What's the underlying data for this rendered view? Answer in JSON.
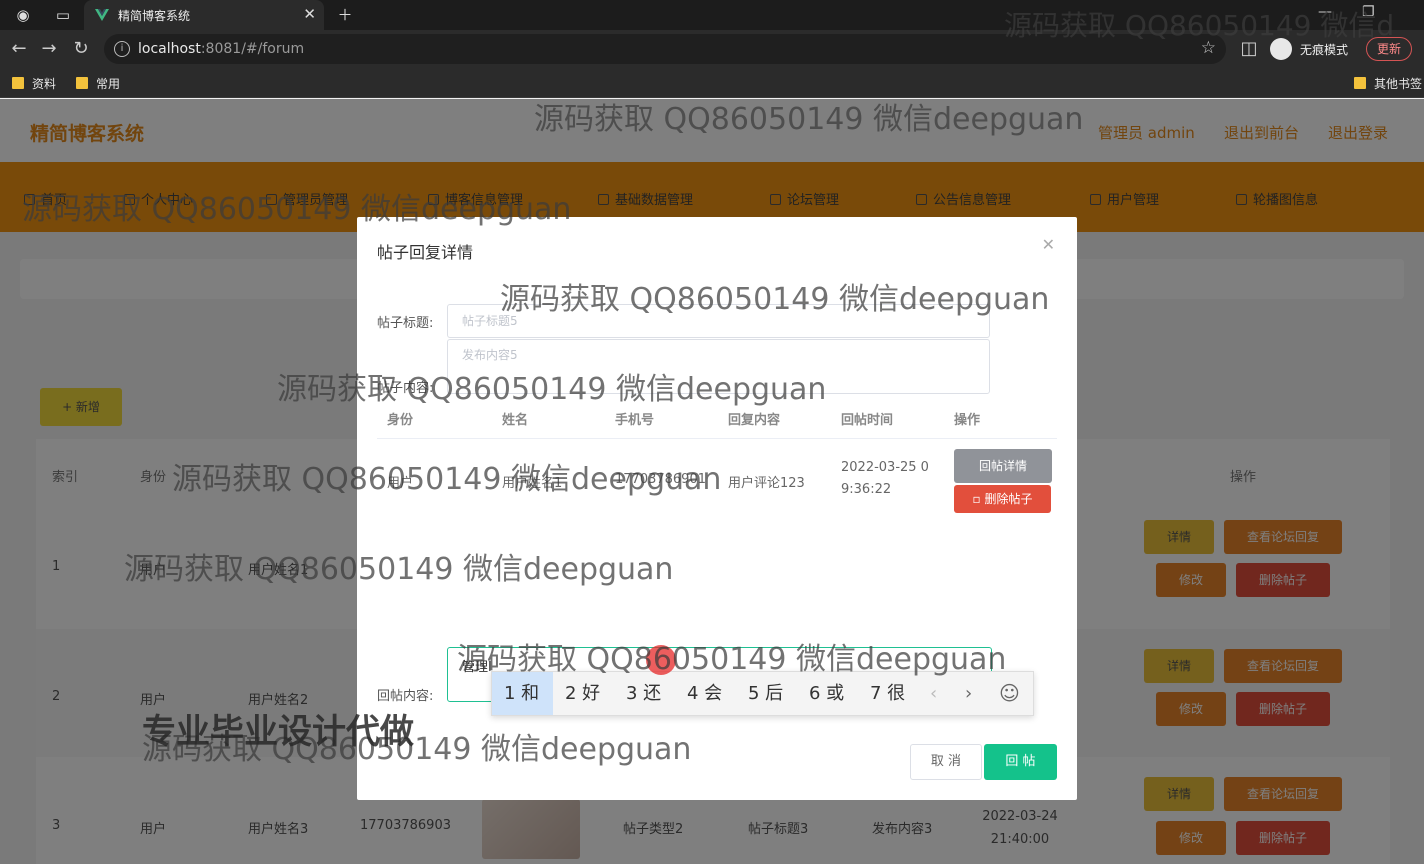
{
  "browser": {
    "tab_title": "精简博客系统",
    "url_host": "localhost",
    "url_rest": ":8081/#/forum",
    "incognito_label": "无痕模式",
    "update_label": "更新",
    "bookmarks": [
      "资料",
      "常用"
    ],
    "other_bookmarks": "其他书签"
  },
  "app": {
    "title": "精简博客系统",
    "header_links": [
      "管理员 admin",
      "退出到前台",
      "退出登录"
    ],
    "menu": [
      "首页",
      "个人中心",
      "管理员管理",
      "博客信息管理",
      "基础数据管理",
      "论坛管理",
      "公告信息管理",
      "用户管理",
      "轮播图信息"
    ],
    "add_button": "+ 新增",
    "table_headers": {
      "index": "索引",
      "identity": "身份",
      "ops": "操作"
    },
    "rows": [
      {
        "index": "1",
        "identity": "用户",
        "name": "用户姓名1"
      },
      {
        "index": "2",
        "identity": "用户",
        "name": "用户姓名2"
      },
      {
        "index": "3",
        "identity": "用户",
        "name": "用户姓名3",
        "phone": "17703786903",
        "type": "帖子类型2",
        "title": "帖子标题3",
        "content": "发布内容3",
        "time": "2022-03-24 21:40:00"
      }
    ],
    "row_buttons": {
      "detail": "详情",
      "view_replies": "查看论坛回复",
      "edit": "修改",
      "delete": "删除帖子"
    }
  },
  "modal": {
    "title": "帖子回复详情",
    "post_title_label": "帖子标题:",
    "post_title_placeholder": "帖子标题5",
    "post_content_label": "帖子内容:",
    "post_content_placeholder": "发布内容5",
    "columns": [
      "身份",
      "姓名",
      "手机号",
      "回复内容",
      "回帖时间",
      "操作"
    ],
    "reply_row": {
      "identity": "用户",
      "name": "用户姓名1",
      "phone": "17703786901",
      "content": "用户评论123",
      "time_line1": "2022-03-25 0",
      "time_line2": "9:36:22"
    },
    "reply_detail_button": "回帖详情",
    "delete_button": "删除帖子",
    "reply_label": "回帖内容:",
    "reply_value": "管理l",
    "cancel_label": "取 消",
    "submit_label": "回 帖"
  },
  "ime": {
    "candidates": [
      "1 和",
      "2 好",
      "3 还",
      "4 会",
      "5 后",
      "6 或",
      "7 很"
    ]
  },
  "watermarks": {
    "text": "源码获取 QQ86050149 微信deepguan",
    "top_right": "源码获取 QQ86050149 微信d",
    "banner": "专业毕业设计代做"
  },
  "colors": {
    "accent": "#f29413",
    "brand_text": "#e48a1d",
    "submit": "#14c28b",
    "delete": "#e24f3c"
  }
}
